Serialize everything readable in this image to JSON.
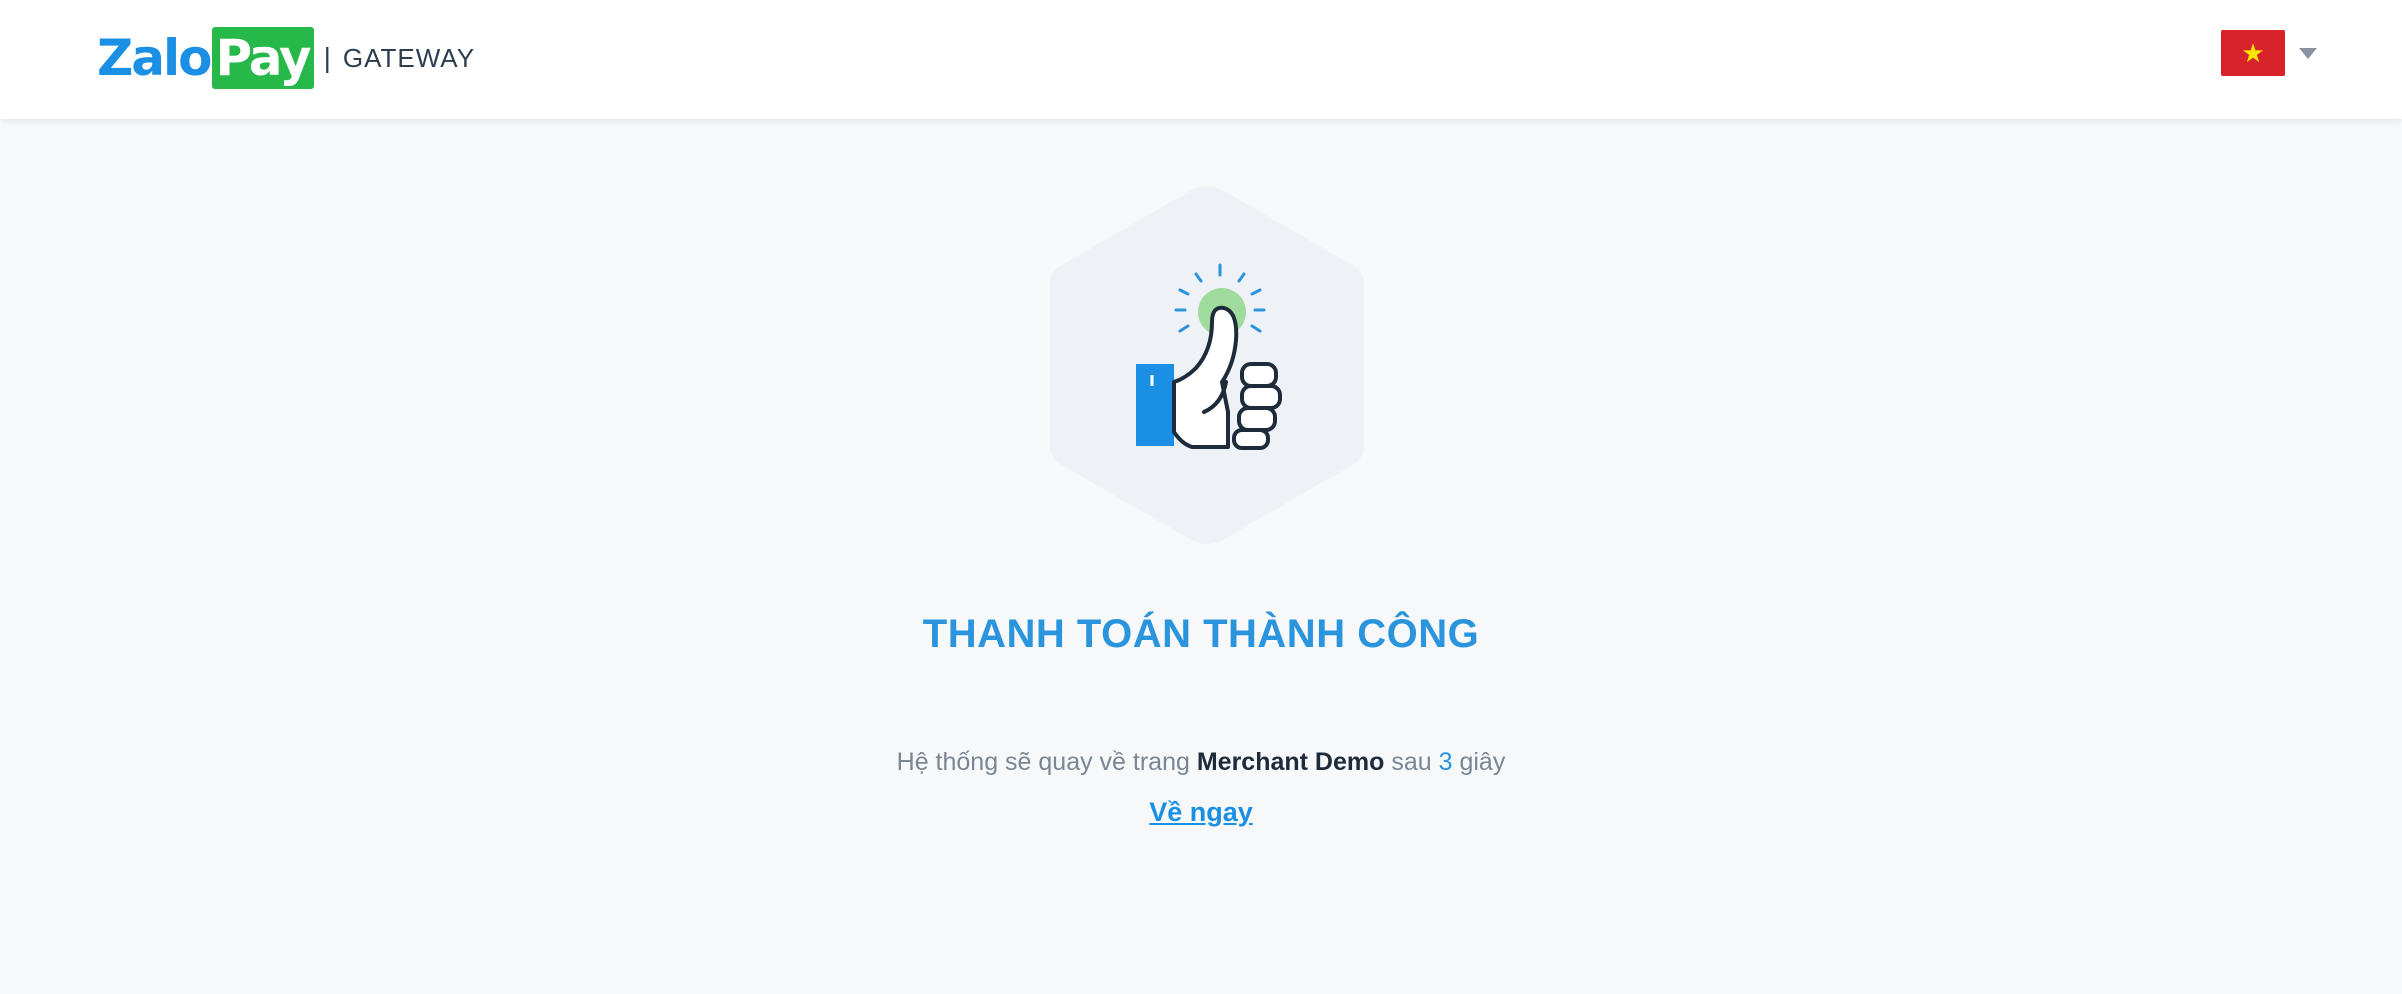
{
  "header": {
    "logo_part1": "Zalo",
    "logo_part2": "Pay",
    "separator": "|",
    "product": "GATEWAY",
    "language_flag": "vietnam-flag-icon"
  },
  "main": {
    "illustration": "thumbs-up-icon",
    "title": "THANH TOÁN THÀNH CÔNG",
    "message_prefix": "Hệ thống sẽ quay về trang",
    "merchant_name": "Merchant Demo",
    "message_mid": "sau",
    "countdown": "3",
    "message_suffix": "giây",
    "return_link": "Về ngay"
  },
  "colors": {
    "brand_blue": "#1a8fe3",
    "brand_green": "#27b84a",
    "title_blue": "#2a94dc",
    "flag_red": "#d8232a",
    "flag_star": "#ffe600"
  }
}
